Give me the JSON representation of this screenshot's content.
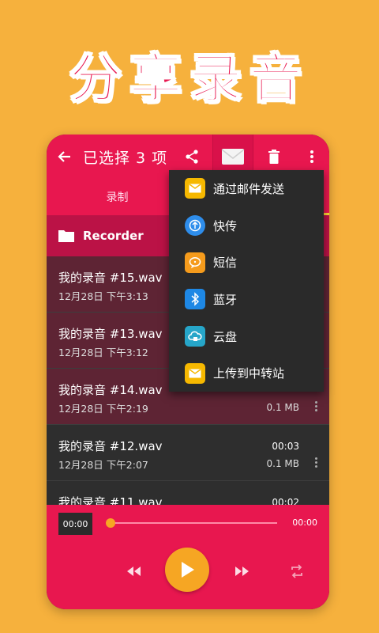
{
  "headline": "分享录音",
  "appbar": {
    "title": "已选择 3 项"
  },
  "tabs": [
    {
      "label": "录制"
    },
    {
      "label": ""
    }
  ],
  "folder": {
    "name": "Recorder"
  },
  "recordings": [
    {
      "name": "我的录音 #15.wav",
      "date": "12月28日 下午3:13",
      "duration": "",
      "size": "",
      "selected": true
    },
    {
      "name": "我的录音 #13.wav",
      "date": "12月28日 下午3:12",
      "duration": "",
      "size": "",
      "selected": true
    },
    {
      "name": "我的录音 #14.wav",
      "date": "12月28日 下午2:19",
      "duration": "",
      "size": "0.1 MB",
      "selected": true
    },
    {
      "name": "我的录音 #12.wav",
      "date": "12月28日 下午2:07",
      "duration": "00:03",
      "size": "0.1 MB",
      "selected": false
    },
    {
      "name": "我的录音 #11.wav",
      "date": "",
      "duration": "00:02",
      "size": "",
      "selected": false
    }
  ],
  "player": {
    "current_time": "00:00",
    "total_time": "00:00",
    "progress": 0
  },
  "share_menu": {
    "items": [
      {
        "label": "通过邮件发送",
        "icon": "email-icon",
        "color": "#F6B800"
      },
      {
        "label": "快传",
        "icon": "quick-transfer-icon",
        "color": "#2E8DEB"
      },
      {
        "label": "短信",
        "icon": "sms-icon",
        "color": "#F59B1C"
      },
      {
        "label": "蓝牙",
        "icon": "bluetooth-icon",
        "color": "#1E88E5"
      },
      {
        "label": "云盘",
        "icon": "cloud-drive-icon",
        "color": "#26A6C9"
      },
      {
        "label": "上传到中转站",
        "icon": "upload-icon",
        "color": "#F6B800"
      }
    ]
  },
  "colors": {
    "background": "#F6B13D",
    "accent": "#E8174F",
    "play": "#F6A623"
  }
}
